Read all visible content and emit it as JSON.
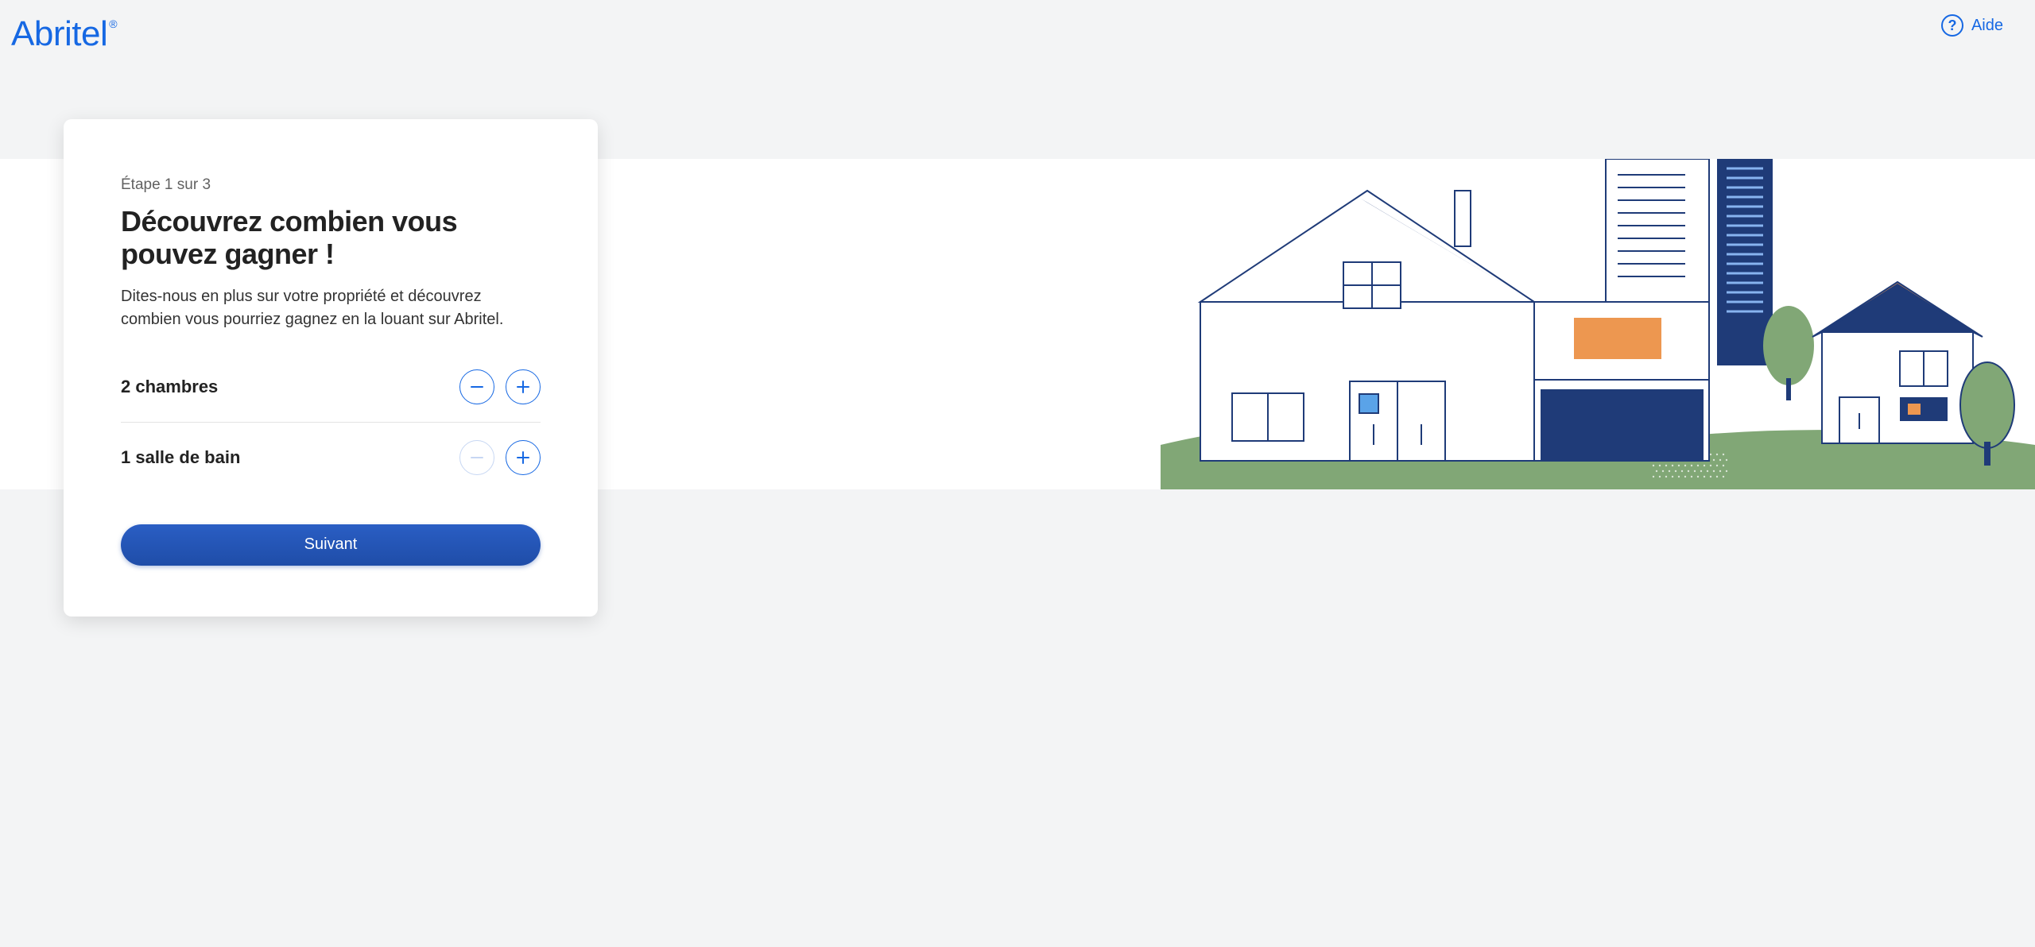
{
  "brand": {
    "name": "Abritel",
    "registered_mark": "®"
  },
  "help": {
    "label": "Aide"
  },
  "card": {
    "step_label": "Étape 1 sur 3",
    "title": "Découvrez combien vous pouvez gagner !",
    "description": "Dites-nous en plus sur votre propriété et découvrez combien vous pourriez gagnez en la louant sur Abritel.",
    "bedrooms": {
      "count": 2,
      "label": "2 chambres",
      "min_reached": false
    },
    "bathrooms": {
      "count": 1,
      "label": "1 salle de bain",
      "min_reached": true
    },
    "next_label": "Suivant"
  }
}
